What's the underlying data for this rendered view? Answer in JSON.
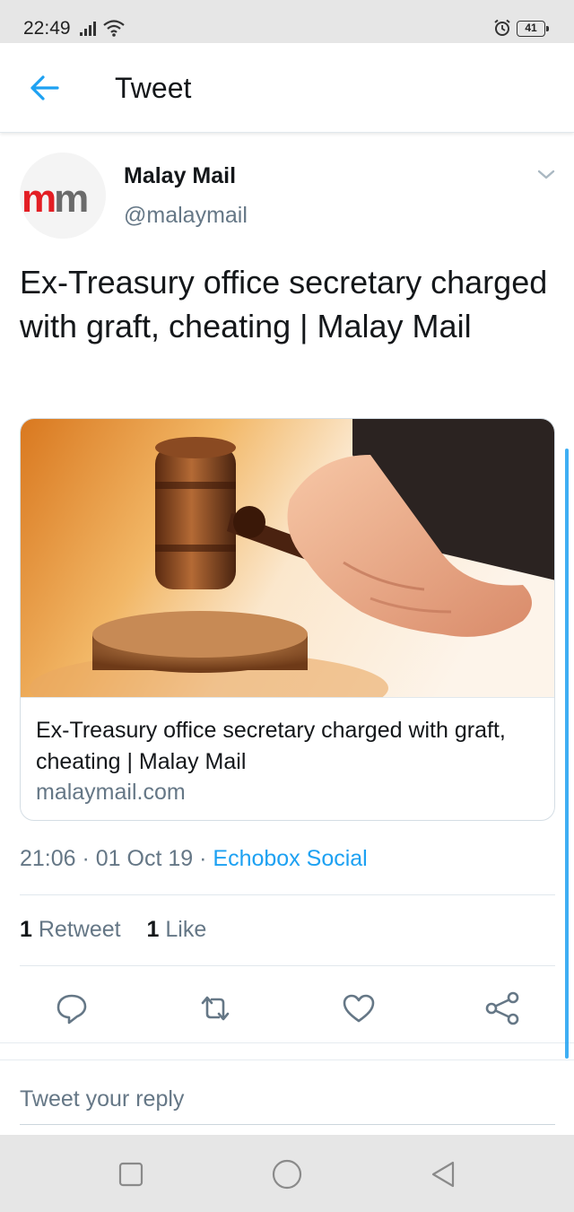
{
  "status_bar": {
    "time": "22:49",
    "battery": "41"
  },
  "app_bar": {
    "title": "Tweet"
  },
  "tweet": {
    "author": {
      "display_name": "Malay Mail",
      "handle": "@malaymail",
      "avatar_logo": "mm"
    },
    "text": "Ex-Treasury office secretary charged with graft, cheating | Malay Mail",
    "card": {
      "title": "Ex-Treasury office secretary charged with graft, cheating | Malay Mail",
      "domain": "malaymail.com"
    },
    "timestamp": "21:06 · 01 Oct 19 · ",
    "source": "Echobox Social",
    "stats": {
      "retweets_count": "1",
      "retweets_label": "Retweet",
      "likes_count": "1",
      "likes_label": "Like"
    }
  },
  "reply": {
    "placeholder": "Tweet your reply"
  },
  "icons": {
    "back": "arrow-left-icon",
    "caret": "chevron-down-icon",
    "reply": "reply-bubble-icon",
    "retweet": "retweet-icon",
    "like": "heart-icon",
    "share": "share-icon"
  },
  "colors": {
    "accent": "#1da1f2",
    "secondary_text": "#657786",
    "primary_text": "#14171a",
    "brand_red": "#e31e24"
  }
}
